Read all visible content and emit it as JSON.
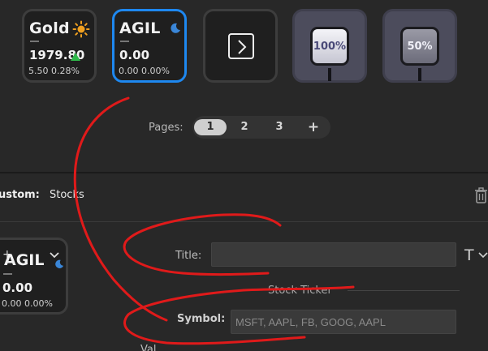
{
  "tiles": [
    {
      "name": "Gold",
      "price": "1979.80",
      "change": "5.50 0.28%",
      "icon": "sun-icon",
      "trend": "up"
    },
    {
      "name": "AGIL",
      "price": "0.00",
      "change": "0.00 0.00%",
      "icon": "moon-icon",
      "selected": true
    }
  ],
  "nav_tile": {
    "icon": "chevron-right-box-icon"
  },
  "brightness": [
    {
      "label": "100%"
    },
    {
      "label": "50%"
    }
  ],
  "pages": {
    "label": "Pages:",
    "items": [
      "1",
      "2",
      "3"
    ],
    "active": "1",
    "add_label": "+"
  },
  "custom": {
    "label": "ustom:",
    "value": "Stocks"
  },
  "preview": {
    "name": "AGIL",
    "price": "0.00",
    "change": "0.00 0.00%",
    "plus": "+"
  },
  "form": {
    "title_label": "Title:",
    "title_value": "",
    "font_button": "T",
    "section_heading": "Stock Ticker",
    "symbol_label": "Symbol:",
    "symbol_placeholder": "MSFT, AAPL, FB, GOOG, AAPL",
    "next_label": "Val"
  },
  "colors": {
    "accent": "#1e88f0",
    "up": "#2fb84a",
    "sun": "#f0a020",
    "moon": "#3a86d8",
    "scribble": "#e01a1a"
  }
}
